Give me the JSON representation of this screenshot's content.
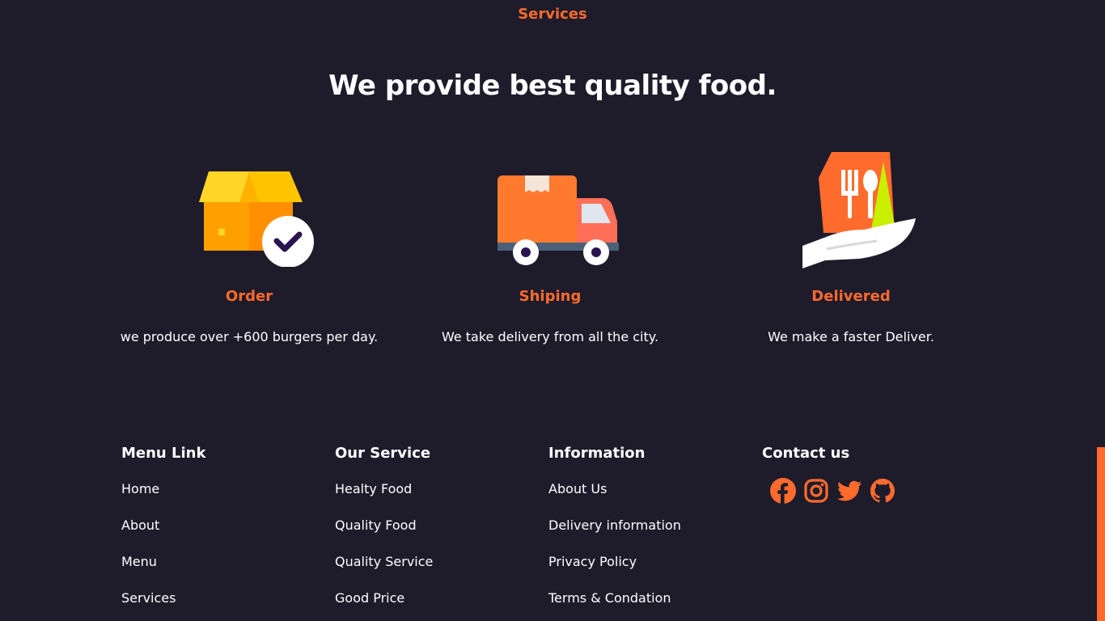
{
  "header": {
    "label": "Services",
    "title": "We provide best quality food."
  },
  "services": [
    {
      "name": "Order",
      "description": "we produce over +600 burgers per day.",
      "icon": "box-check-icon"
    },
    {
      "name": "Shiping",
      "description": "We take delivery from all the city.",
      "icon": "delivery-truck-icon"
    },
    {
      "name": "Delivered",
      "description": "We make a faster Deliver.",
      "icon": "hand-food-bag-icon"
    }
  ],
  "footer": {
    "menu_link": {
      "heading": "Menu Link",
      "items": [
        "Home",
        "About",
        "Menu",
        "Services"
      ]
    },
    "our_service": {
      "heading": "Our Service",
      "items": [
        "Healty Food",
        "Quality Food",
        "Quality Service",
        "Good Price"
      ]
    },
    "information": {
      "heading": "Information",
      "items": [
        "About Us",
        "Delivery information",
        "Privacy Policy",
        "Terms & Condation"
      ]
    },
    "contact": {
      "heading": "Contact us",
      "socials": [
        "facebook-icon",
        "instagram-icon",
        "twitter-icon",
        "github-icon"
      ]
    }
  },
  "colors": {
    "background": "#1e1b2b",
    "accent": "#ff6b2c",
    "text": "#ffffff"
  }
}
